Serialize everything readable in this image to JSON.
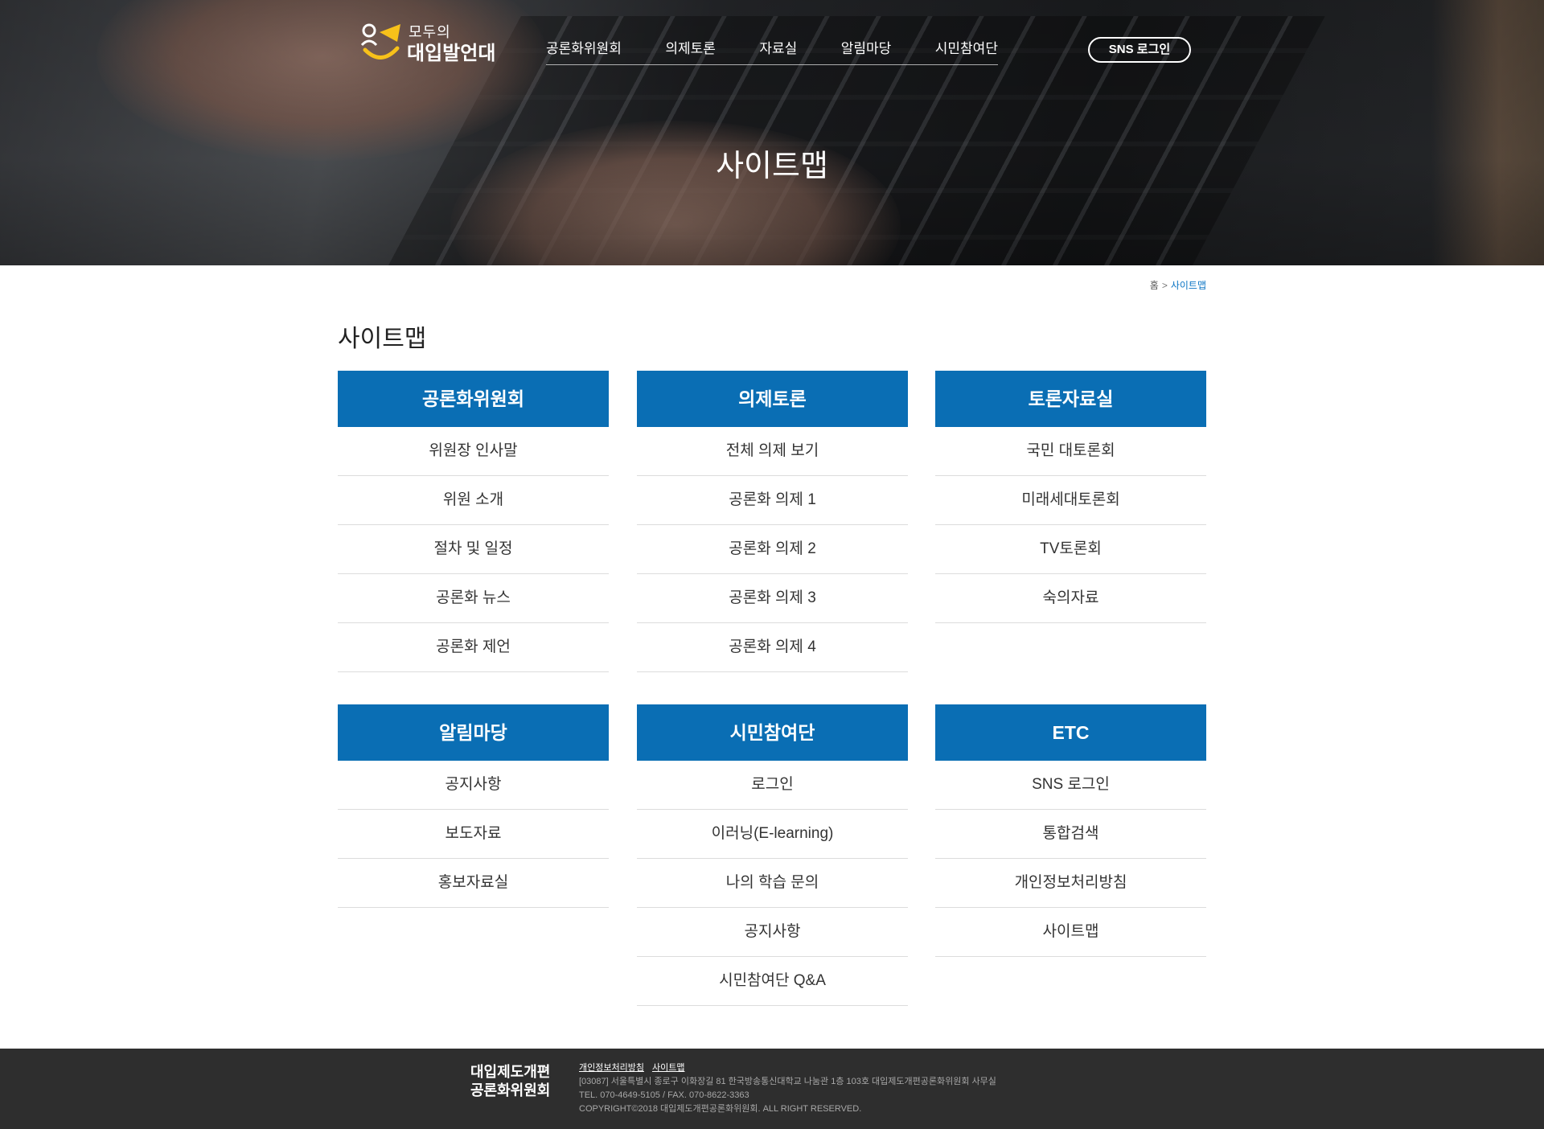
{
  "header": {
    "logo_small": "모두의",
    "logo_big": "대입발언대",
    "nav": [
      "공론화위원회",
      "의제토론",
      "자료실",
      "알림마당",
      "시민참여단"
    ],
    "sns_login": "SNS 로그인",
    "hero_title": "사이트맵"
  },
  "breadcrumb": {
    "home": "홈",
    "separator": ">",
    "current": "사이트맵"
  },
  "page_title": "사이트맵",
  "sitemap": [
    {
      "title": "공론화위원회",
      "items": [
        "위원장 인사말",
        "위원 소개",
        "절차 및 일정",
        "공론화 뉴스",
        "공론화 제언"
      ]
    },
    {
      "title": "의제토론",
      "items": [
        "전체 의제 보기",
        "공론화 의제 1",
        "공론화 의제 2",
        "공론화 의제 3",
        "공론화 의제 4"
      ]
    },
    {
      "title": "토론자료실",
      "items": [
        "국민 대토론회",
        "미래세대토론회",
        "TV토론회",
        "숙의자료"
      ]
    },
    {
      "title": "알림마당",
      "items": [
        "공지사항",
        "보도자료",
        "홍보자료실"
      ]
    },
    {
      "title": "시민참여단",
      "items": [
        "로그인",
        "이러닝(E-learning)",
        "나의 학습 문의",
        "공지사항",
        "시민참여단 Q&A"
      ]
    },
    {
      "title": "ETC",
      "items": [
        "SNS 로그인",
        "통합검색",
        "개인정보처리방침",
        "사이트맵"
      ]
    }
  ],
  "footer": {
    "logo_line1": "대입제도개편",
    "logo_line2": "공론화위원회",
    "links": [
      "개인정보처리방침",
      "사이트맵"
    ],
    "address": "[03087] 서울특별시 종로구 이화장길 81 한국방송통신대학교 나눔관 1층 103호 대입제도개편공론화위원회 사무실",
    "contact": "TEL. 070-4649-5105 / FAX. 070-8622-3363",
    "copyright": "COPYRIGHT©2018 대입제도개편공론화위원회. ALL RIGHT RESERVED."
  },
  "colors": {
    "accent_blue": "#0a6eb4",
    "breadcrumb_current": "#0a74c4",
    "footer_bg": "#2e2e2e",
    "logo_yellow": "#f7c11a"
  }
}
